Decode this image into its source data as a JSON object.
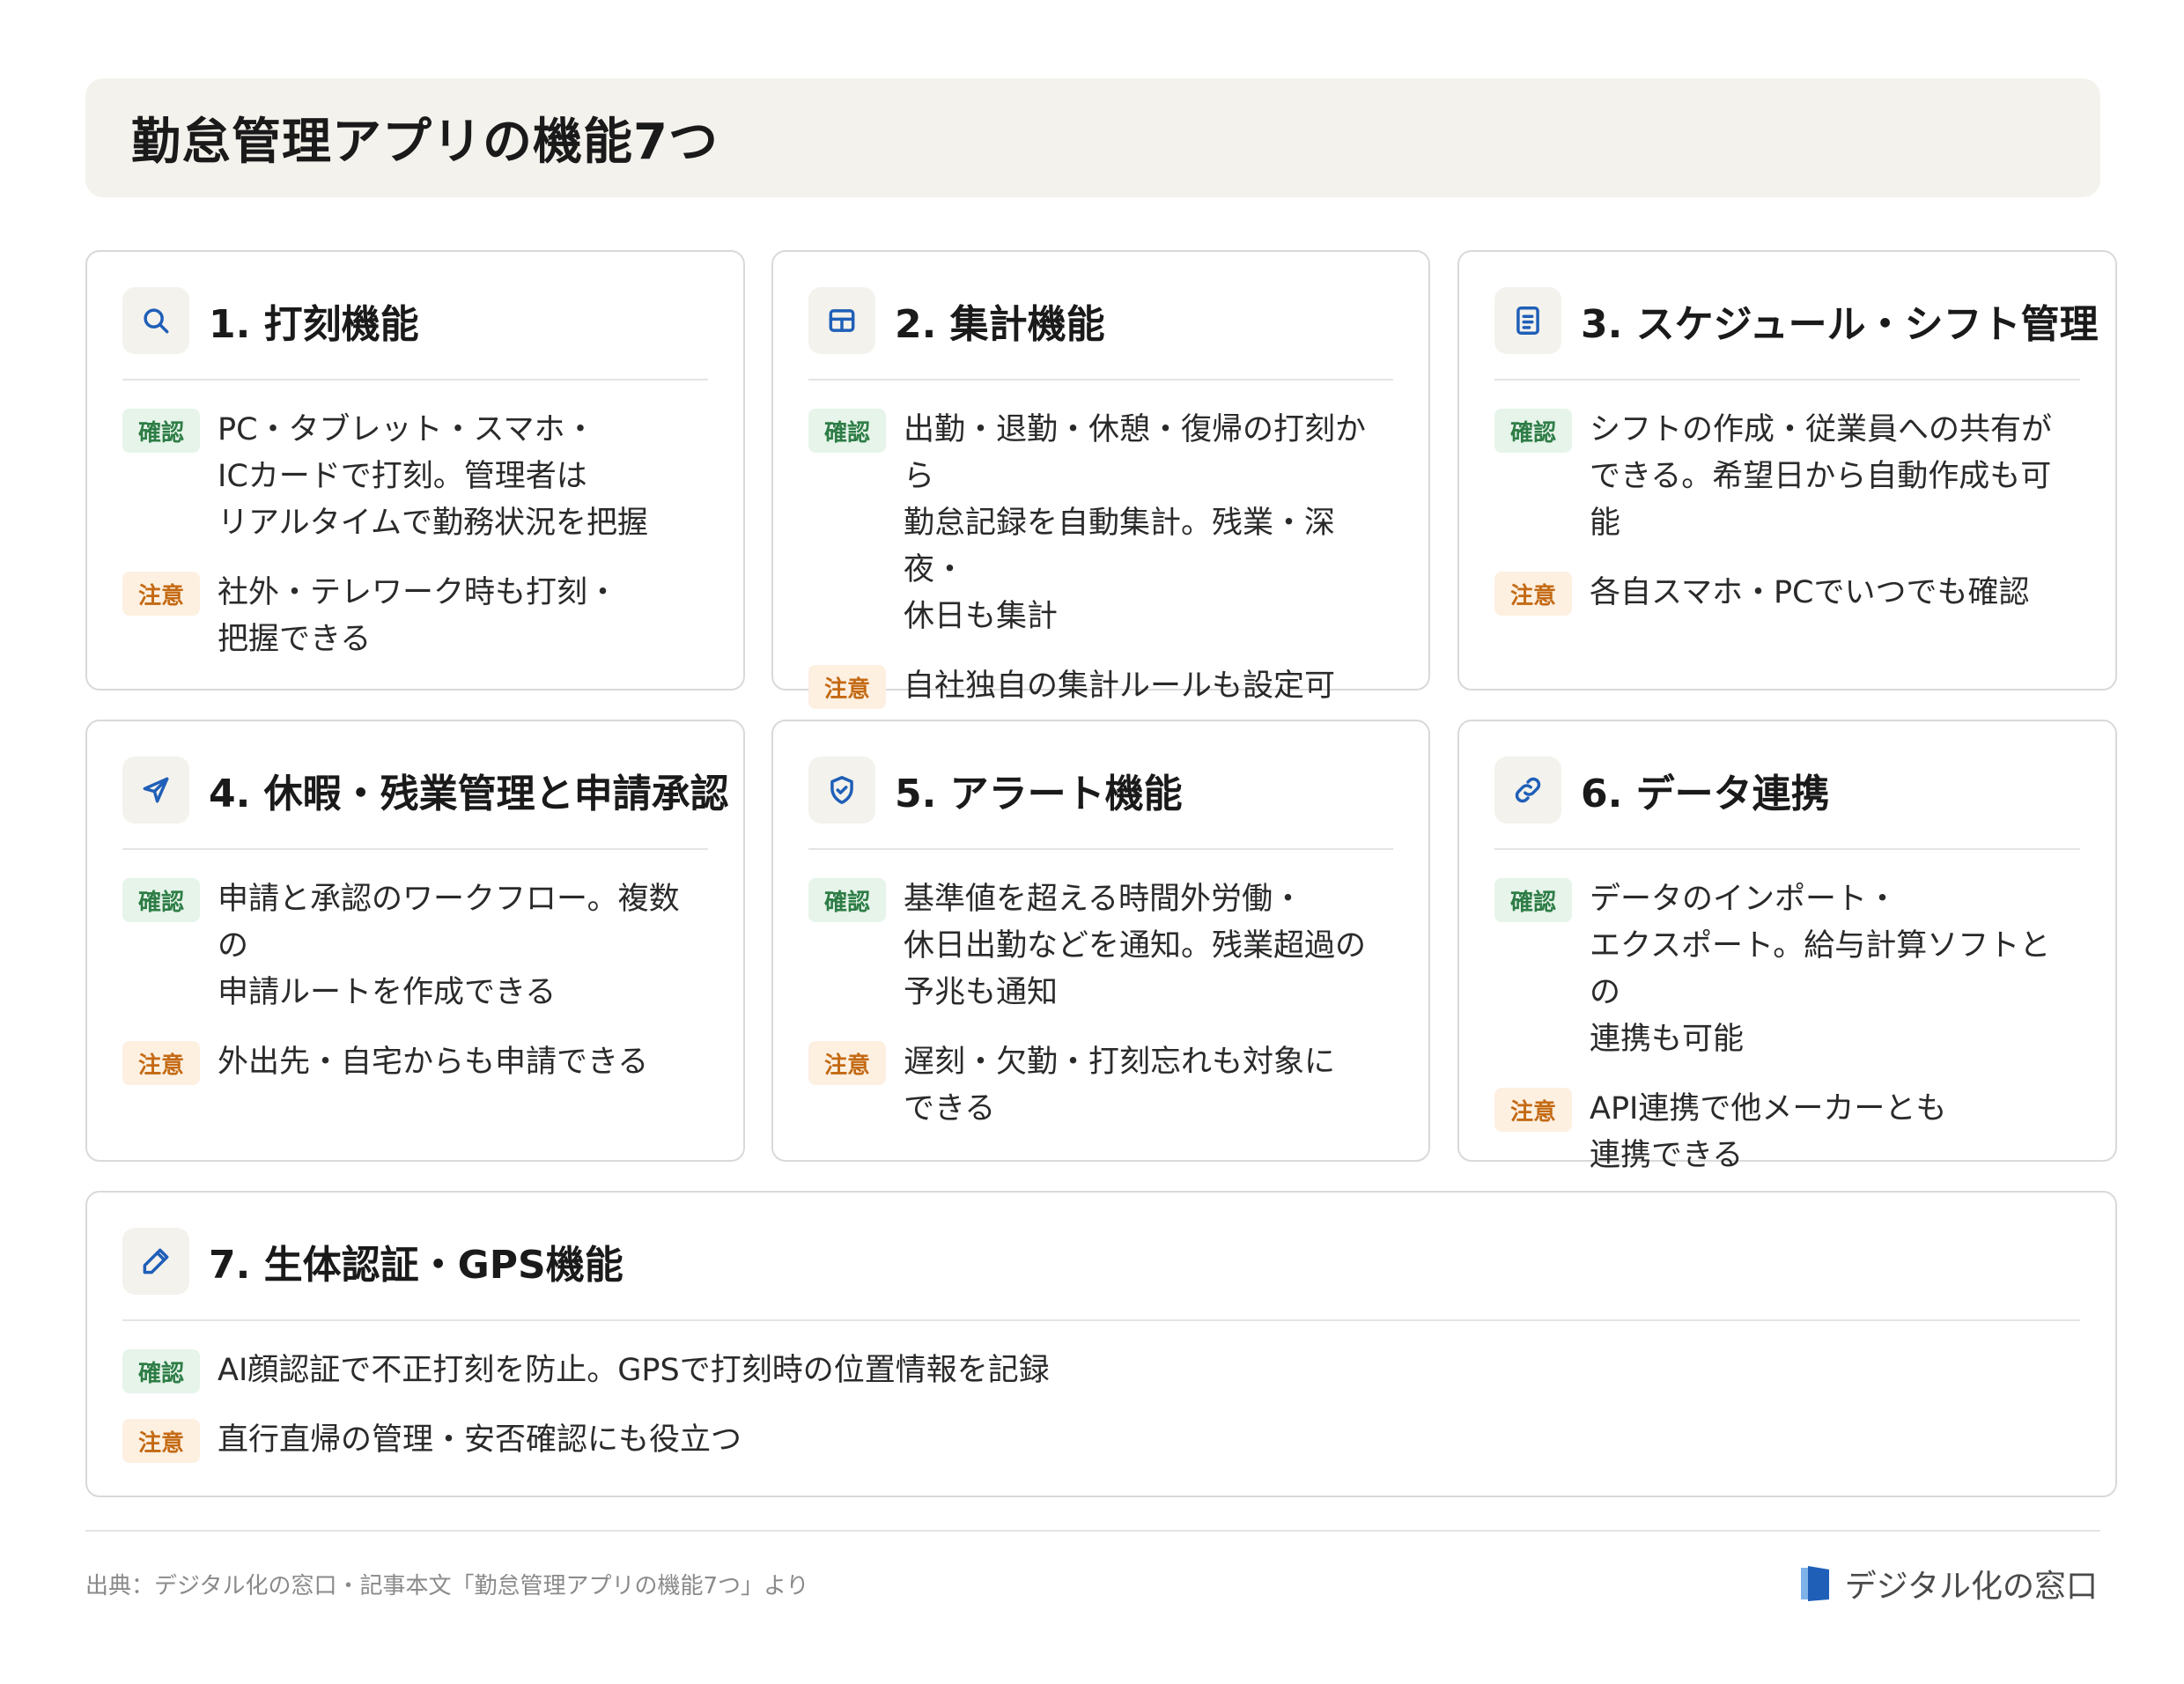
{
  "title": "勤怠管理アプリの機能7つ",
  "labels": {
    "confirm": "確認",
    "caution": "注意"
  },
  "cards": [
    {
      "title": "1. 打刻機能",
      "icon": "search-icon",
      "confirm": "PC・タブレット・スマホ・\nICカードで打刻。管理者は\nリアルタイムで勤務状況を把握",
      "caution": "社外・テレワーク時も打刻・\n把握できる"
    },
    {
      "title": "2. 集計機能",
      "icon": "table-icon",
      "confirm": "出勤・退勤・休憩・復帰の打刻から\n勤怠記録を自動集計。残業・深夜・\n休日も集計",
      "caution": "自社独自の集計ルールも設定可"
    },
    {
      "title": "3. スケジュール・シフト管理",
      "icon": "document-icon",
      "confirm": "シフトの作成・従業員への共有が\nできる。希望日から自動作成も可能",
      "caution": "各自スマホ・PCでいつでも確認"
    },
    {
      "title": "4. 休暇・残業管理と申請承認",
      "icon": "send-icon",
      "confirm": "申請と承認のワークフロー。複数の\n申請ルートを作成できる",
      "caution": "外出先・自宅からも申請できる"
    },
    {
      "title": "5. アラート機能",
      "icon": "shield-check-icon",
      "confirm": "基準値を超える時間外労働・\n休日出勤などを通知。残業超過の\n予兆も通知",
      "caution": "遅刻・欠勤・打刻忘れも対象に\nできる"
    },
    {
      "title": "6. データ連携",
      "icon": "link-icon",
      "confirm": "データのインポート・\nエクスポート。給与計算ソフトとの\n連携も可能",
      "caution": "API連携で他メーカーとも\n連携できる"
    },
    {
      "title": "7. 生体認証・GPS機能",
      "icon": "pencil-icon",
      "confirm": "AI顔認証で不正打刻を防止。GPSで打刻時の位置情報を記録",
      "caution": "直行直帰の管理・安否確認にも役立つ"
    }
  ],
  "footer": {
    "source": "出典：デジタル化の窓口・記事本文「勤怠管理アプリの機能7つ」より",
    "brand": "デジタル化の窓口"
  },
  "colors": {
    "accent": "#1f5fb8",
    "confirm": "#2e7d46",
    "caution": "#c46a14",
    "header_bg": "#f4f2ec"
  }
}
